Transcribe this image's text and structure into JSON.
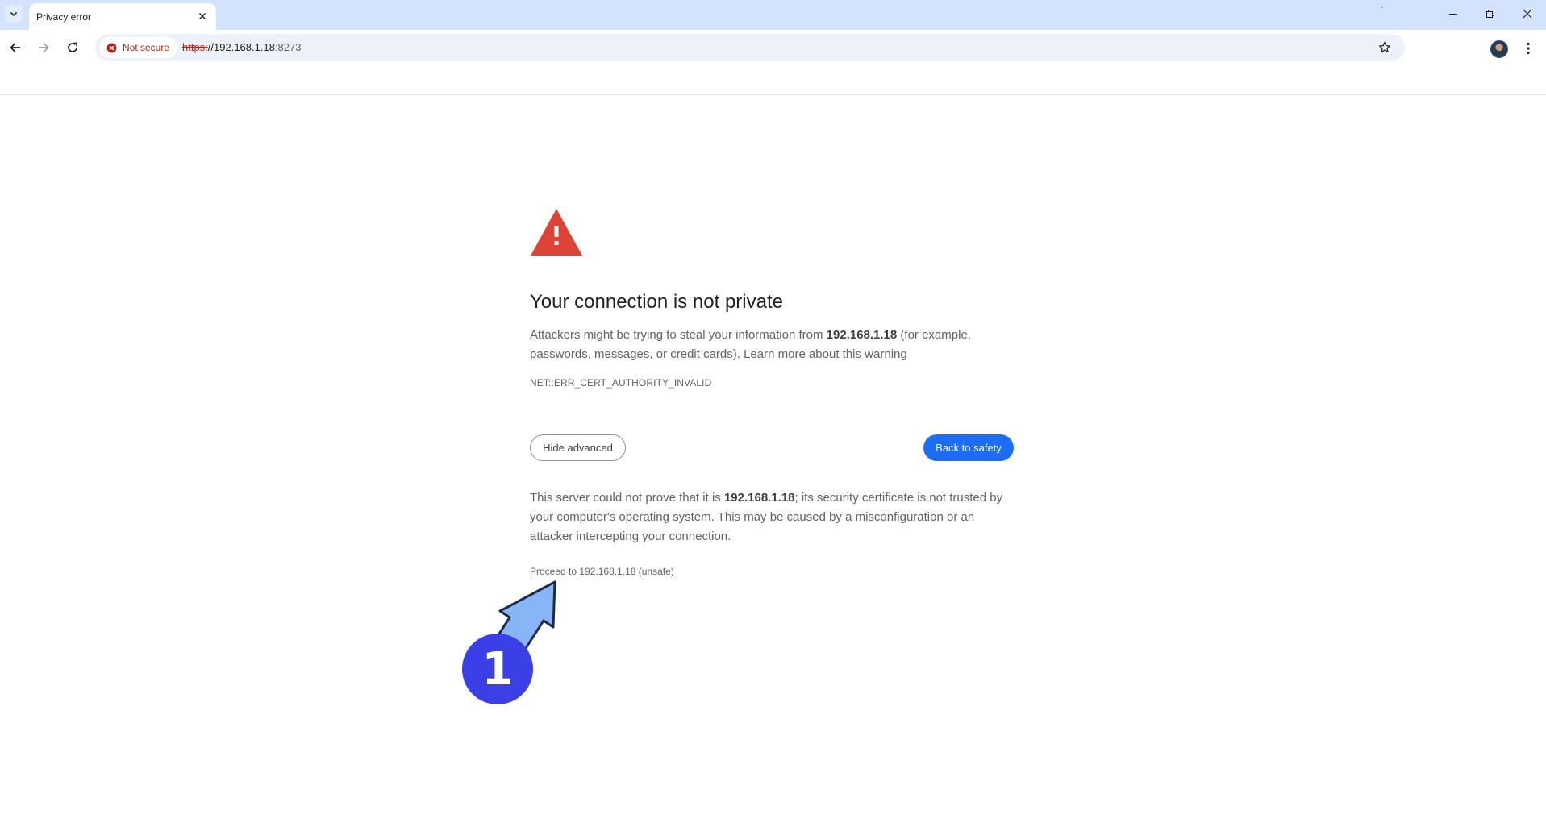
{
  "tab": {
    "title": "Privacy error"
  },
  "window": {
    "minimize_mark": "·"
  },
  "address_bar": {
    "security_chip": "Not secure",
    "url_scheme": "https:",
    "url_host": "//192.168.1.18",
    "url_port": ":8273"
  },
  "page": {
    "heading": "Your connection is not private",
    "intro_before": "Attackers might be trying to steal your information from ",
    "intro_host": "192.168.1.18",
    "intro_after": " (for example, passwords, messages, or credit cards). ",
    "learn_more": "Learn more about this warning",
    "error_code": "NET::ERR_CERT_AUTHORITY_INVALID",
    "hide_advanced": "Hide advanced",
    "back_to_safety": "Back to safety",
    "details_before": "This server could not prove that it is ",
    "details_host": "192.168.1.18",
    "details_after": "; its security certificate is not trusted by your computer's operating system. This may be caused by a misconfiguration or an attacker intercepting your connection.",
    "proceed_link": "Proceed to 192.168.1.18 (unsafe)"
  },
  "annotation": {
    "step_number": "1"
  },
  "colors": {
    "warning_red": "#db4437",
    "primary_blue": "#1b6ef3",
    "tab_strip": "#d3e3fd",
    "annotation_badge": "#3b3fe6",
    "annotation_arrow": "#8ab4f8"
  }
}
